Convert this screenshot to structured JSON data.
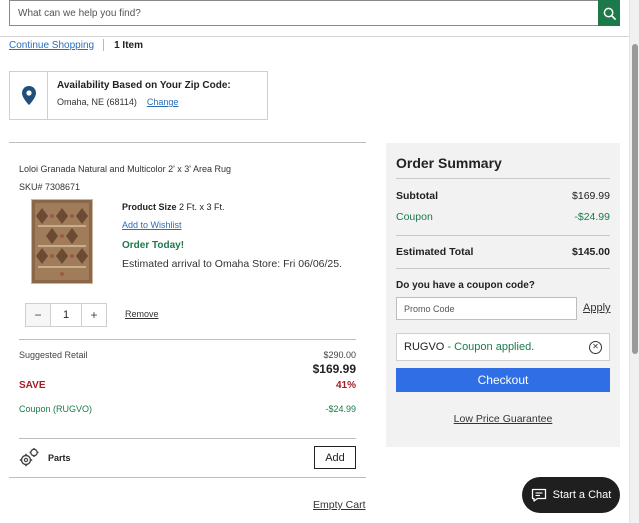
{
  "search": {
    "placeholder": "What can we help you find?",
    "icon": "search-icon"
  },
  "nav": {
    "continue_shopping": "Continue Shopping",
    "item_count": "1 Item"
  },
  "zip": {
    "title": "Availability Based on Your Zip Code:",
    "location": "Omaha, NE (68114)",
    "change_label": "Change",
    "icon": "location-pin-icon"
  },
  "item": {
    "name": "Loloi Granada Natural and Multicolor 2' x 3' Area Rug",
    "sku": "SKU# 7308671",
    "size_label": "Product Size",
    "size_value": "2 Ft. x 3 Ft.",
    "wishlist_label": "Add to Wishlist",
    "order_today": "Order Today!",
    "arrival": "Estimated arrival to Omaha Store: Fri 06/06/25.",
    "quantity": "1",
    "minus": "−",
    "plus": "+",
    "remove_label": "Remove"
  },
  "pricing": {
    "suggested_label": "Suggested Retail",
    "suggested_value": "$290.00",
    "price": "$169.99",
    "save_label": "SAVE",
    "save_percent": "41%",
    "coupon_label": "Coupon (RUGVO)",
    "coupon_value": "-$24.99"
  },
  "parts": {
    "label": "Parts",
    "add_label": "Add",
    "icon": "gears-icon"
  },
  "empty_cart": "Empty Cart",
  "summary": {
    "title": "Order Summary",
    "subtotal_label": "Subtotal",
    "subtotal_value": "$169.99",
    "coupon_label": "Coupon",
    "coupon_value": "-$24.99",
    "total_label": "Estimated Total",
    "total_value": "$145.00",
    "coupon_question": "Do you have a coupon code?",
    "promo_placeholder": "Promo Code",
    "apply_label": "Apply",
    "applied_code": "RUGVO",
    "applied_text": " - Coupon applied.",
    "checkout_label": "Checkout",
    "low_price": "Low Price Guarantee"
  },
  "chat": {
    "label": "Start a Chat",
    "icon": "chat-icon"
  },
  "colors": {
    "green": "#1c7a4a",
    "blue": "#2f6ee5",
    "red": "#a51c24",
    "link": "#2a6ebb"
  }
}
